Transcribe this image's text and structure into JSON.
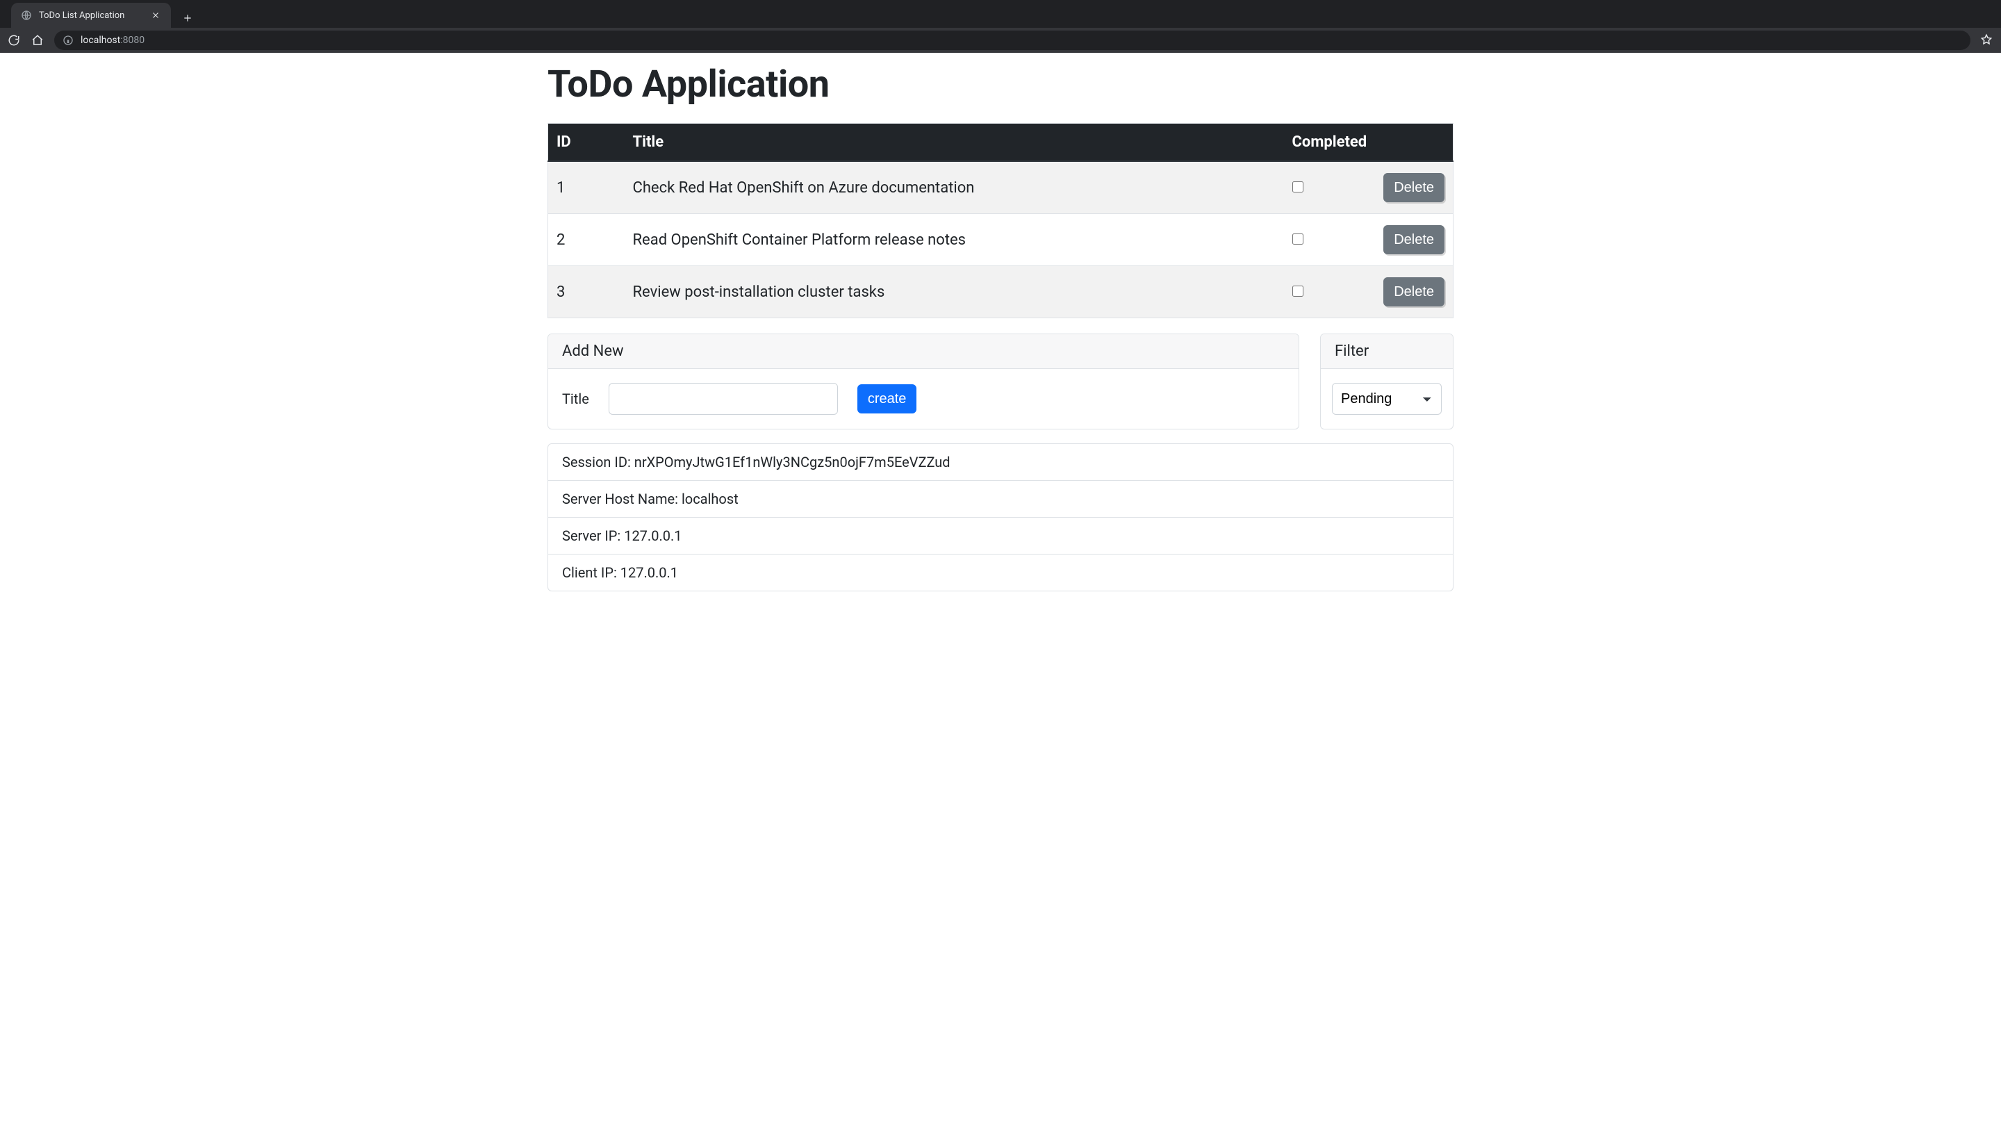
{
  "browser": {
    "tab_title": "ToDo List Application",
    "url_host": "localhost",
    "url_port": ":8080"
  },
  "page": {
    "heading": "ToDo Application"
  },
  "table": {
    "headers": {
      "id": "ID",
      "title": "Title",
      "completed": "Completed"
    },
    "rows": [
      {
        "id": "1",
        "title": "Check Red Hat OpenShift on Azure documentation",
        "completed": false,
        "delete_label": "Delete"
      },
      {
        "id": "2",
        "title": "Read OpenShift Container Platform release notes",
        "completed": false,
        "delete_label": "Delete"
      },
      {
        "id": "3",
        "title": "Review post-installation cluster tasks",
        "completed": false,
        "delete_label": "Delete"
      }
    ]
  },
  "add_new": {
    "card_title": "Add New",
    "title_label": "Title",
    "input_value": "",
    "create_label": "create"
  },
  "filter": {
    "card_title": "Filter",
    "options": [
      "Pending"
    ],
    "selected": "Pending"
  },
  "info": {
    "session_label": "Session ID: ",
    "session_value": "nrXPOmyJtwG1Ef1nWly3NCgz5n0ojF7m5EeVZZud",
    "server_host_label": "Server Host Name: ",
    "server_host_value": "localhost",
    "server_ip_label": "Server IP: ",
    "server_ip_value": "127.0.0.1",
    "client_ip_label": "Client IP: ",
    "client_ip_value": "127.0.0.1"
  }
}
